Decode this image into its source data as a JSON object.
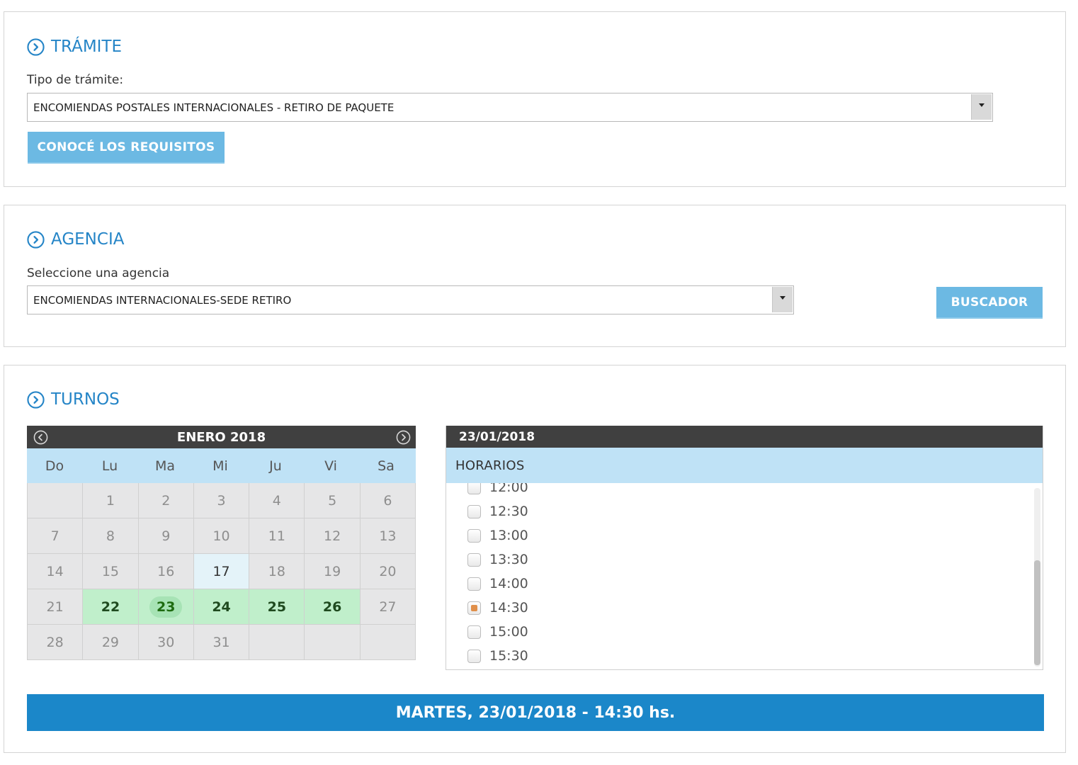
{
  "tramite": {
    "title": "TRÁMITE",
    "label": "Tipo de trámite:",
    "selected": "ENCOMIENDAS POSTALES INTERNACIONALES - RETIRO DE PAQUETE",
    "requirements_button": "CONOCÉ LOS REQUISITOS"
  },
  "agencia": {
    "title": "AGENCIA",
    "label": "Seleccione una agencia",
    "selected": "ENCOMIENDAS INTERNACIONALES-SEDE RETIRO",
    "search_button": "BUSCADOR"
  },
  "turnos": {
    "title": "TURNOS",
    "calendar": {
      "month_label": "ENERO 2018",
      "weekdays": [
        "Do",
        "Lu",
        "Ma",
        "Mi",
        "Ju",
        "Vi",
        "Sa"
      ],
      "days": [
        "",
        "1",
        "2",
        "3",
        "4",
        "5",
        "6",
        "7",
        "8",
        "9",
        "10",
        "11",
        "12",
        "13",
        "14",
        "15",
        "16",
        "17",
        "18",
        "19",
        "20",
        "21",
        "22",
        "23",
        "24",
        "25",
        "26",
        "27",
        "28",
        "29",
        "30",
        "31",
        "",
        "",
        ""
      ],
      "today": "17",
      "available_days": [
        "22",
        "23",
        "24",
        "25",
        "26"
      ],
      "selected_day": "23"
    },
    "schedule": {
      "date": "23/01/2018",
      "heading": "HORARIOS",
      "slots": [
        "12:00",
        "12:30",
        "13:00",
        "13:30",
        "14:00",
        "14:30",
        "15:00",
        "15:30"
      ],
      "checked_slot": "14:30"
    },
    "summary": "MARTES, 23/01/2018 - 14:30 hs."
  },
  "colors": {
    "accent": "#2585c7",
    "button_light": "#6cb9e3",
    "summary_bar": "#1b87c9",
    "available_day": "#c0efcb",
    "dark_header": "#404040",
    "weekday_header": "#bfe2f6",
    "checked": "#e08f4a"
  },
  "icons": {
    "section": "chevron-circle-right-icon",
    "calendar_prev": "chevron-circle-left-icon",
    "calendar_next": "chevron-circle-right-icon",
    "dropdown": "caret-down-icon"
  }
}
